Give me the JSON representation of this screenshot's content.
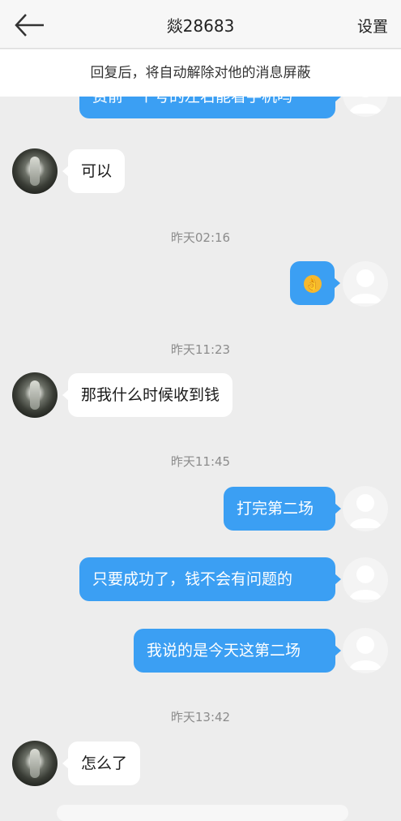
{
  "header": {
    "title": "燚28683",
    "settings_label": "设置"
  },
  "notice": "回复后，将自动解除对他的消息屏蔽",
  "partial_message": "费前一个号的左右能看手机吗",
  "messages": {
    "m1": "可以",
    "t1": "昨天02:16",
    "m2": "👌",
    "t2": "昨天11:23",
    "m3": "那我什么时候收到钱",
    "t3": "昨天11:45",
    "m4": "打完第二场",
    "m5": "只要成功了，钱不会有问题的",
    "m6": "我说的是今天这第二场",
    "t4": "昨天13:42",
    "m7": "怎么了"
  },
  "colors": {
    "sent_bubble": "#3b9ff3",
    "received_bubble": "#ffffff",
    "background": "#ededed"
  }
}
